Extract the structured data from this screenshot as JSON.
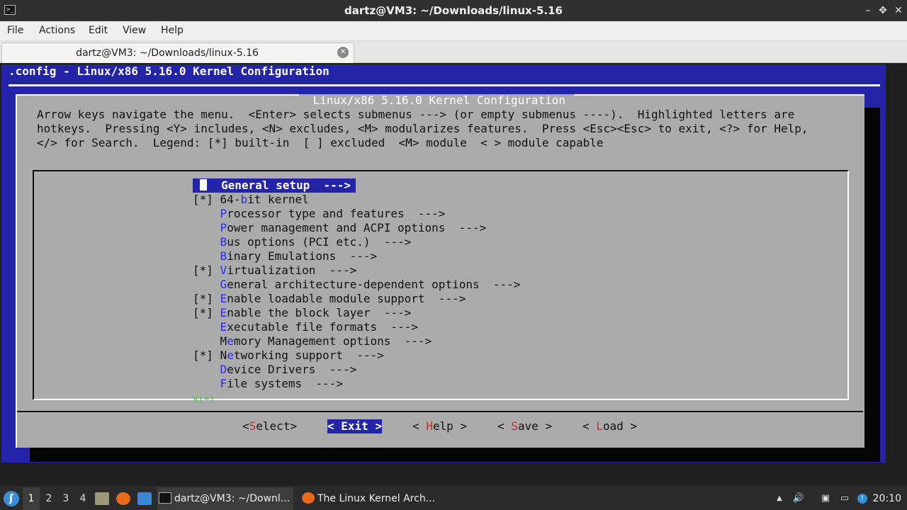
{
  "window": {
    "title": "dartz@VM3: ~/Downloads/linux-5.16",
    "icon_glyph": ">_",
    "controls": {
      "minimize": "–",
      "maximize": "✥",
      "close": "✕"
    }
  },
  "menubar": [
    "File",
    "Actions",
    "Edit",
    "View",
    "Help"
  ],
  "tab": {
    "label": "dartz@VM3: ~/Downloads/linux-5.16",
    "close": "✕"
  },
  "terminal": {
    "config_title": ".config - Linux/x86 5.16.0 Kernel Configuration",
    "dialog_title": " Linux/x86 5.16.0 Kernel Configuration ",
    "help_lines": [
      "Arrow keys navigate the menu.  <Enter> selects submenus ---> (or empty submenus ----).  Highlighted letters are",
      "hotkeys.  Pressing <Y> includes, <N> excludes, <M> modularizes features.  Press <Esc><Esc> to exit, <?> for Help,",
      "</> for Search.  Legend: [*] built-in  [ ] excluded  <M> module  < > module capable"
    ],
    "menu_items": [
      {
        "state": "   ",
        "hotkey": "",
        "pre": "",
        "rest": "General setup  --->",
        "selected": true
      },
      {
        "state": "[*]",
        "hotkey": "b",
        "pre": "64-",
        "rest": "it kernel",
        "selected": false
      },
      {
        "state": "   ",
        "hotkey": "P",
        "pre": "",
        "rest": "rocessor type and features  --->",
        "selected": false
      },
      {
        "state": "   ",
        "hotkey": "P",
        "pre": "",
        "rest": "ower management and ACPI options  --->",
        "selected": false
      },
      {
        "state": "   ",
        "hotkey": "B",
        "pre": "",
        "rest": "us options (PCI etc.)  --->",
        "selected": false
      },
      {
        "state": "   ",
        "hotkey": "B",
        "pre": "",
        "rest": "inary Emulations  --->",
        "selected": false
      },
      {
        "state": "[*]",
        "hotkey": "V",
        "pre": "",
        "rest": "irtualization  --->",
        "selected": false
      },
      {
        "state": "   ",
        "hotkey": "G",
        "pre": "",
        "rest": "eneral architecture-dependent options  --->",
        "selected": false
      },
      {
        "state": "[*]",
        "hotkey": "E",
        "pre": "",
        "rest": "nable loadable module support  --->",
        "selected": false
      },
      {
        "state": "[*]",
        "hotkey": "E",
        "pre": "",
        "rest": "nable the block layer  --->",
        "selected": false
      },
      {
        "state": "   ",
        "hotkey": "E",
        "pre": "",
        "rest": "xecutable file formats  --->",
        "selected": false
      },
      {
        "state": "   ",
        "hotkey": "e",
        "pre": "M",
        "rest": "mory Management options  --->",
        "selected": false
      },
      {
        "state": "[*]",
        "hotkey": "e",
        "pre": "N",
        "rest": "tworking support  --->",
        "selected": false
      },
      {
        "state": "   ",
        "hotkey": "D",
        "pre": "",
        "rest": "evice Drivers  --->",
        "selected": false
      },
      {
        "state": "   ",
        "hotkey": "F",
        "pre": "",
        "rest": "ile systems  --->",
        "selected": false
      }
    ],
    "more_indicator": "v(+)",
    "buttons": [
      {
        "left": "<",
        "hotkey": "S",
        "rest": "elect",
        "right": ">",
        "active": false
      },
      {
        "left": "< ",
        "hotkey": "E",
        "rest": "xit",
        "right": " >",
        "active": true
      },
      {
        "left": "< ",
        "hotkey": "H",
        "rest": "elp",
        "right": " >",
        "active": false
      },
      {
        "left": "< ",
        "hotkey": "S",
        "rest": "ave",
        "right": " >",
        "active": false
      },
      {
        "left": "< ",
        "hotkey": "L",
        "rest": "oad",
        "right": " >",
        "active": false
      }
    ]
  },
  "taskbar": {
    "start_glyph": "ʃ",
    "workspaces": [
      "1",
      "2",
      "3",
      "4"
    ],
    "active_workspace": "1",
    "tasks": [
      {
        "label": "dartz@VM3: ~/Downl...",
        "icon": "terminal-icon"
      },
      {
        "label": "The Linux Kernel Arch...",
        "icon": "firefox-icon"
      }
    ],
    "tray_glyphs": {
      "notifications": "▲",
      "volume": "🔊",
      "clipboard": "▣",
      "network": "▭",
      "updates": "!"
    },
    "clock": "20:10"
  },
  "colors": {
    "backdrop_blue": "#2424a8",
    "dialog_grey": "#ababab",
    "hotkey_blue": "#2a2af0",
    "hotkey_red": "#c43030",
    "more_green": "#32d232"
  }
}
